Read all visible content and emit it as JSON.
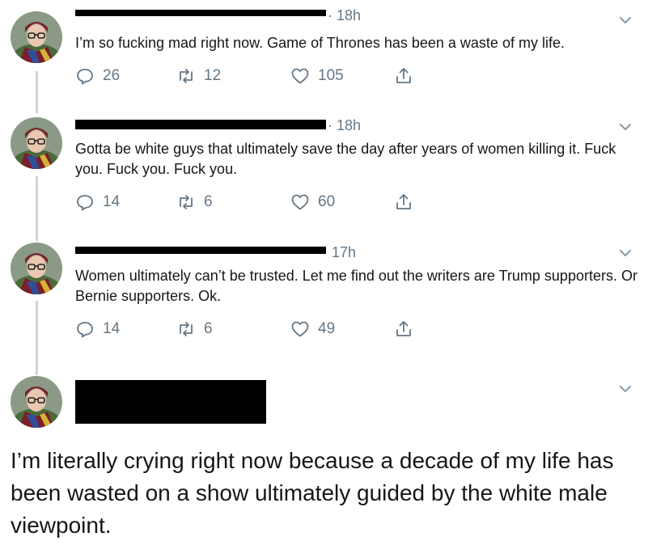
{
  "colors": {
    "text": "#14171a",
    "muted": "#657786",
    "thread_line": "#ccd6dd",
    "redaction": "#000000"
  },
  "tweets": [
    {
      "timestamp": "· 18h",
      "text": "I’m so fucking mad right now. Game of Thrones has been a waste of my life.",
      "replies": "26",
      "retweets": "12",
      "likes": "105"
    },
    {
      "timestamp": "· 18h",
      "text": "Gotta be white guys that ultimately save the day after years of women killing it. Fuck you. Fuck you. Fuck you.",
      "replies": "14",
      "retweets": "6",
      "likes": "60"
    },
    {
      "timestamp": "17h",
      "text": "Women ultimately can’t be trusted. Let me find out the writers are Trump supporters. Or Bernie supporters. Ok.",
      "replies": "14",
      "retweets": "6",
      "likes": "49"
    }
  ],
  "caption": "I’m literally crying right now because a decade of my life has been wasted on a show ultimately guided by the white male viewpoint.",
  "icons": {
    "reply": "reply-icon",
    "retweet": "retweet-icon",
    "like": "heart-icon",
    "share": "share-icon",
    "menu": "chevron-down-icon"
  }
}
